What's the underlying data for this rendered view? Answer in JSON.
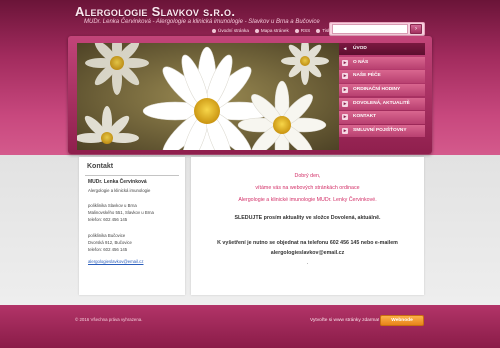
{
  "header": {
    "title": "Alergologie Slavkov s.r.o.",
    "subtitle": "MUDr. Lenka Červinková - Alergologie a klinická imunologie - Slavkov u Brna a Bučovice",
    "links": [
      {
        "label": "Úvodní stránka"
      },
      {
        "label": "Mapa stránek"
      },
      {
        "label": "RSS"
      },
      {
        "label": "Tisk"
      }
    ],
    "search": {
      "value": "",
      "placeholder": "",
      "button_icon": "search-icon"
    }
  },
  "nav": {
    "items": [
      {
        "label": "ÚVOD",
        "active": true
      },
      {
        "label": "O NÁS",
        "active": false
      },
      {
        "label": "NAŠE PÉČE",
        "active": false
      },
      {
        "label": "ORDINAČNÍ HODINY",
        "active": false
      },
      {
        "label": "DOVOLENÁ, AKTUALITĚ",
        "active": false
      },
      {
        "label": "KONTAKT",
        "active": false
      },
      {
        "label": "SMLUVNÍ POJIŠŤOVNY",
        "active": false
      }
    ]
  },
  "sidebar": {
    "title": "Kontakt",
    "doctor": "MUDr. Lenka Červinková",
    "specialty": "Alergologie a klinická imunologie",
    "office1": {
      "name": "poliklinika Slavkov u Brna",
      "address": "Malinovského 551, Slavkov u Brna",
      "phone": "telefon: 602 456 145"
    },
    "office2": {
      "name": "poliklinika Bučovice",
      "address": "Dvorská 912, Bučovice",
      "phone": "telefon: 602 456 145"
    },
    "email": "alergologieslavkov@email.cz"
  },
  "main": {
    "greeting": "Dobrý den,",
    "welcome": "vítáme vás na webových stránkách ordinace",
    "practice": "Alergologie a klinické imunologie MUDr. Lenky Červinkové.",
    "notice": "SLEDUJTE prosím aktuality ve složce Dovolená, aktuálně.",
    "appointment": "K vyšetření je nutno se objednat na telefonu 602 456 145 nebo e-mailem",
    "email": "alergologieslavkov@email.cz",
    "dash": "."
  },
  "footer": {
    "copyright": "© 2016 Všechna práva vyhrazena.",
    "promo": "Vytvořte si www stránky zdarma!",
    "button": "Webnode"
  },
  "colors": {
    "brand": "#a02a5c",
    "accent_text": "#d33068",
    "nav_active": "#5d0f30",
    "footer_button": "#e8831a"
  }
}
